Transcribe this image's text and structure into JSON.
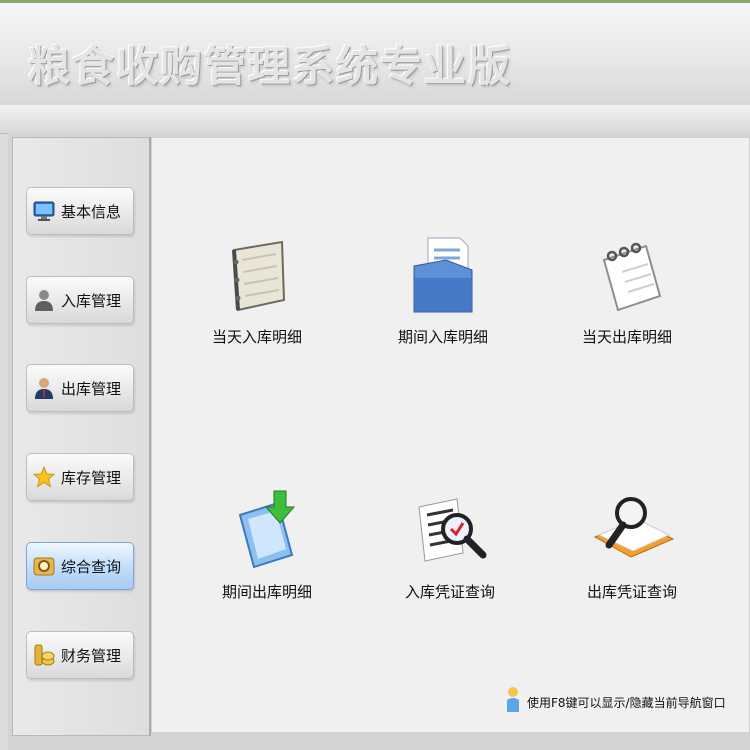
{
  "app": {
    "title": "粮食收购管理系统专业版"
  },
  "sidebar": {
    "items": [
      {
        "label": "基本信息",
        "icon": "monitor-icon"
      },
      {
        "label": "入库管理",
        "icon": "user-icon"
      },
      {
        "label": "出库管理",
        "icon": "user-suit-icon"
      },
      {
        "label": "库存管理",
        "icon": "star-icon"
      },
      {
        "label": "综合查询",
        "icon": "magnifier-folder-icon",
        "active": true
      },
      {
        "label": "财务管理",
        "icon": "coins-icon"
      }
    ]
  },
  "main": {
    "tiles": [
      {
        "label": "当天入库明细",
        "icon": "notebook-icon"
      },
      {
        "label": "期间入库明细",
        "icon": "document-folder-icon"
      },
      {
        "label": "当天出库明细",
        "icon": "spiral-notepad-icon"
      },
      {
        "label": "期间出库明细",
        "icon": "download-document-icon"
      },
      {
        "label": "入库凭证查询",
        "icon": "search-list-icon"
      },
      {
        "label": "出库凭证查询",
        "icon": "search-book-icon"
      }
    ],
    "hint": {
      "text": "使用F8键可以显示/隐藏当前导航窗口",
      "icon": "info-person-icon"
    }
  },
  "colors": {
    "active_nav": "#bfdcfa",
    "panel": "#f0f0f0",
    "header": "#e6e6e6"
  }
}
